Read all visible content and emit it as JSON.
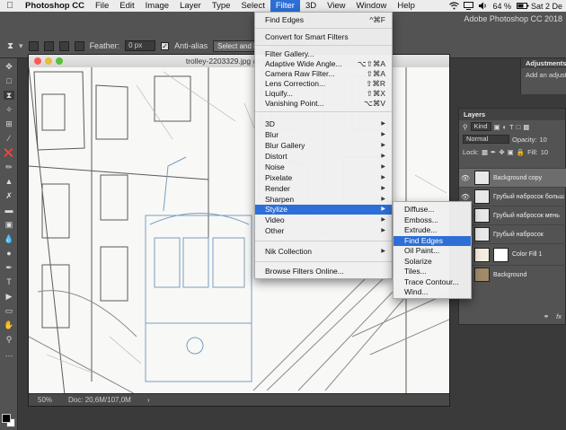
{
  "menubar": {
    "app_name": "Photoshop CC",
    "items": [
      "File",
      "Edit",
      "Image",
      "Layer",
      "Type",
      "Select",
      "Filter",
      "3D",
      "View",
      "Window",
      "Help"
    ],
    "active_item": "Filter",
    "battery": "64 %",
    "clock": "Sat 2 De"
  },
  "options_bar": {
    "feather_label": "Feather:",
    "feather_value": "0 px",
    "antialias_label": "Anti-alias",
    "select_mask_label": "Select and Mask",
    "app_title": "Adobe Photoshop CC 2018"
  },
  "document": {
    "title": "trolley-2203329.jpg @ 50% (Ba",
    "zoom": "50%",
    "doc_size": "Doc: 20,6M/107,0M"
  },
  "adjustments": {
    "tab": "Adjustments",
    "subtitle": "Add an adjust"
  },
  "layers_panel": {
    "tab": "Layers",
    "kind_label": "Kind",
    "blend_mode": "Normal",
    "opacity_label": "Opacity:",
    "opacity_value": "10",
    "lock_label": "Lock:",
    "fill_label": "Fill:",
    "fill_value": "10",
    "layers": [
      {
        "name": "Background copy",
        "selected": true,
        "visible": true
      },
      {
        "name": "Грубый набросок больш",
        "selected": false,
        "visible": true
      },
      {
        "name": "Грубый набросок мень",
        "selected": false,
        "visible": false
      },
      {
        "name": "Грубый набросок",
        "selected": false,
        "visible": false
      },
      {
        "name": "Color Fill 1",
        "selected": false,
        "visible": false
      },
      {
        "name": "Background",
        "selected": false,
        "visible": false
      }
    ],
    "footer_fx": "fx"
  },
  "filter_menu": {
    "items": [
      {
        "label": "Find Edges",
        "shortcut": "^⌘F"
      },
      {
        "label": "Convert for Smart Filters"
      },
      {
        "label": "Filter Gallery..."
      },
      {
        "label": "Adaptive Wide Angle...",
        "shortcut": "⌥⇧⌘A"
      },
      {
        "label": "Camera Raw Filter...",
        "shortcut": "⇧⌘A"
      },
      {
        "label": "Lens Correction...",
        "shortcut": "⇧⌘R"
      },
      {
        "label": "Liquify...",
        "shortcut": "⇧⌘X"
      },
      {
        "label": "Vanishing Point...",
        "shortcut": "⌥⌘V"
      },
      {
        "label": "3D",
        "submenu": true
      },
      {
        "label": "Blur",
        "submenu": true
      },
      {
        "label": "Blur Gallery",
        "submenu": true
      },
      {
        "label": "Distort",
        "submenu": true
      },
      {
        "label": "Noise",
        "submenu": true
      },
      {
        "label": "Pixelate",
        "submenu": true
      },
      {
        "label": "Render",
        "submenu": true
      },
      {
        "label": "Sharpen",
        "submenu": true
      },
      {
        "label": "Stylize",
        "submenu": true,
        "highlight": true
      },
      {
        "label": "Video",
        "submenu": true
      },
      {
        "label": "Other",
        "submenu": true
      },
      {
        "label": "Nik Collection",
        "submenu": true
      },
      {
        "label": "Browse Filters Online..."
      }
    ]
  },
  "stylize_submenu": {
    "items": [
      "Diffuse...",
      "Emboss...",
      "Extrude...",
      "Find Edges",
      "Oil Paint...",
      "Solarize",
      "Tiles...",
      "Trace Contour...",
      "Wind..."
    ],
    "highlighted": "Find Edges"
  },
  "colors": {
    "accent": "#2d6fd6",
    "panel": "#535353",
    "canvas_bg": "#f8f8f6"
  }
}
